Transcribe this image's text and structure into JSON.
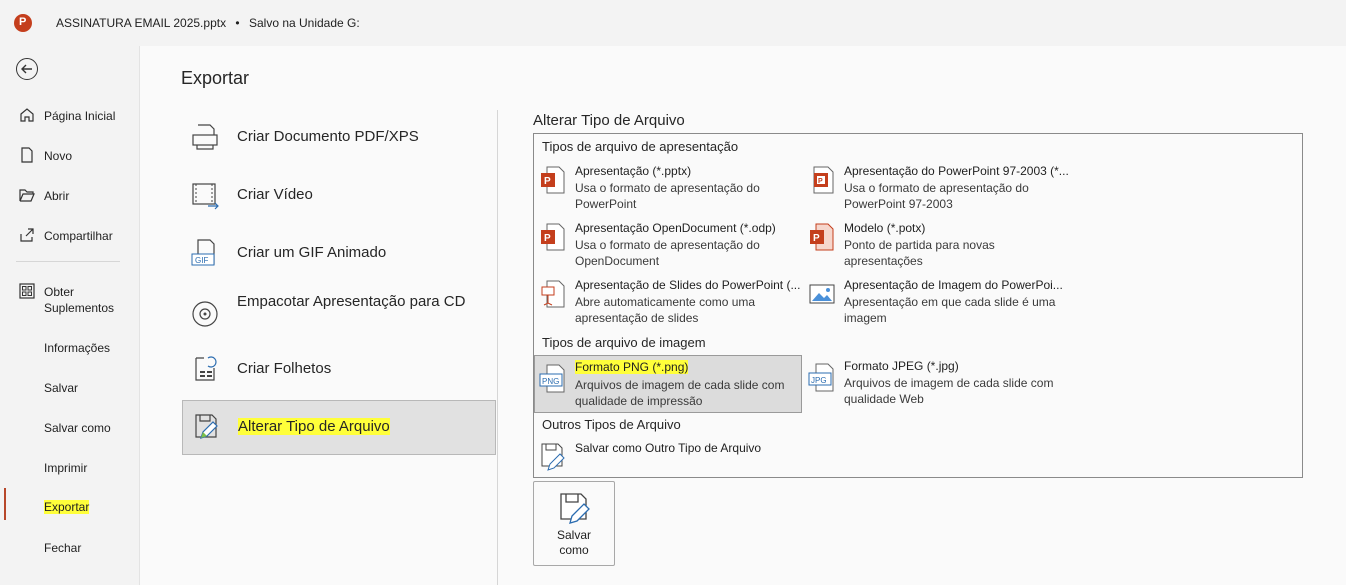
{
  "titlebar": {
    "filename": "ASSINATURA EMAIL 2025.pptx",
    "separator": "•",
    "save_status": "Salvo na Unidade G:"
  },
  "nav": {
    "items": [
      {
        "label": "Página Inicial",
        "icon": "home-icon"
      },
      {
        "label": "Novo",
        "icon": "new-file-icon"
      },
      {
        "label": "Abrir",
        "icon": "folder-open-icon"
      },
      {
        "label": "Compartilhar",
        "icon": "share-icon"
      },
      {
        "label": "Obter Suplementos",
        "icon": "addins-icon"
      },
      {
        "label": "Informações"
      },
      {
        "label": "Salvar"
      },
      {
        "label": "Salvar como"
      },
      {
        "label": "Imprimir"
      },
      {
        "label": "Exportar",
        "active": true
      },
      {
        "label": "Fechar"
      }
    ]
  },
  "main": {
    "title": "Exportar",
    "options": [
      {
        "label": "Criar Documento PDF/XPS",
        "icon": "pdf-icon"
      },
      {
        "label": "Criar Vídeo",
        "icon": "video-icon"
      },
      {
        "label": "Criar um GIF Animado",
        "icon": "gif-icon"
      },
      {
        "label": "Empacotar Apresentação para CD",
        "icon": "cd-icon"
      },
      {
        "label": "Criar Folhetos",
        "icon": "handouts-icon"
      },
      {
        "label": "Alterar Tipo de Arquivo",
        "icon": "change-file-type-icon",
        "selected": true
      }
    ]
  },
  "right_panel": {
    "title": "Alterar Tipo de Arquivo",
    "sections": {
      "presentation": "Tipos de arquivo de apresentação",
      "image": "Tipos de arquivo de imagem",
      "other": "Outros Tipos de Arquivo"
    },
    "file_types": [
      {
        "name": "Apresentação (*.pptx)",
        "desc": "Usa o formato de apresentação do PowerPoint"
      },
      {
        "name": "Apresentação do PowerPoint 97-2003 (*...",
        "desc": "Usa o formato de apresentação do PowerPoint 97-2003"
      },
      {
        "name": "Apresentação OpenDocument (*.odp)",
        "desc": "Usa o formato de apresentação do OpenDocument"
      },
      {
        "name": "Modelo (*.potx)",
        "desc": "Ponto de partida para novas apresentações"
      },
      {
        "name": "Apresentação de Slides do PowerPoint (...",
        "desc": "Abre automaticamente como uma apresentação de slides"
      },
      {
        "name": "Apresentação de Imagem do PowerPoi...",
        "desc": "Apresentação em que cada slide é uma imagem"
      },
      {
        "name": "Formato PNG (*.png)",
        "desc": "Arquivos de imagem de cada slide com qualidade de impressão",
        "selected": true
      },
      {
        "name": "Formato JPEG (*.jpg)",
        "desc": "Arquivos de imagem de cada slide com qualidade Web"
      },
      {
        "name": "Salvar como Outro Tipo de Arquivo",
        "desc": ""
      }
    ],
    "save_as_button": "Salvar como"
  },
  "colors": {
    "accent": "#b7472a",
    "highlight": "#ffff3a",
    "selected_bg": "#dcdcdc"
  }
}
